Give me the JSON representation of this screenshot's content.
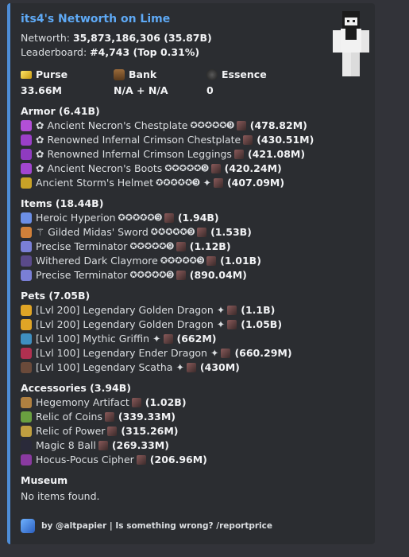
{
  "embed": {
    "title": "its4's Networth on Lime",
    "networth_label": "Networth:",
    "networth_value": "35,873,186,306 (35.87B)",
    "leaderboard_label": "Leaderboard:",
    "leaderboard_value": "#4,743 (Top 0.31%)",
    "stats": [
      {
        "label": "Purse",
        "value": "33.66M",
        "icon": "gold-bars-icon"
      },
      {
        "label": "Bank",
        "value": "N/A + N/A",
        "icon": "bank-chest-icon"
      },
      {
        "label": "Essence",
        "value": "0",
        "icon": "essence-icon"
      }
    ],
    "sections": [
      {
        "title": "Armor (6.41B)",
        "items": [
          {
            "name": "✿ Ancient Necron's Chestplate",
            "stars": "✪✪✪✪✪➒",
            "extra": "",
            "price": "(478.82M)",
            "color": "#b24fd6"
          },
          {
            "name": "✿ Renowned Infernal Crimson Chestplate",
            "stars": "",
            "extra": "",
            "price": "(430.51M)",
            "color": "#9a3fc8"
          },
          {
            "name": "✿ Renowned Infernal Crimson Leggings",
            "stars": "",
            "extra": "",
            "price": "(421.08M)",
            "color": "#8f3bc0"
          },
          {
            "name": "✿ Ancient Necron's Boots",
            "stars": "✪✪✪✪✪➒",
            "extra": "",
            "price": "(420.24M)",
            "color": "#a246cf"
          },
          {
            "name": "Ancient Storm's Helmet",
            "stars": "✪✪✪✪✪➒",
            "extra": "✦",
            "price": "(407.09M)",
            "color": "#c9a227"
          }
        ]
      },
      {
        "title": "Items (18.44B)",
        "items": [
          {
            "name": "Heroic Hyperion",
            "stars": "✪✪✪✪✪➒",
            "extra": "",
            "price": "(1.94B)",
            "color": "#6c8fe6"
          },
          {
            "name": "⚚ Gilded Midas' Sword",
            "stars": "✪✪✪✪✪➒",
            "extra": "",
            "price": "(1.53B)",
            "color": "#d0803a"
          },
          {
            "name": "Precise Terminator",
            "stars": "✪✪✪✪✪➒",
            "extra": "",
            "price": "(1.12B)",
            "color": "#7a7fd6"
          },
          {
            "name": "Withered Dark Claymore",
            "stars": "✪✪✪✪✪➒",
            "extra": "",
            "price": "(1.01B)",
            "color": "#5a4a8a"
          },
          {
            "name": "Precise Terminator",
            "stars": "✪✪✪✪✪➒",
            "extra": "",
            "price": "(890.04M)",
            "color": "#7a7fd6"
          }
        ]
      },
      {
        "title": "Pets (7.05B)",
        "items": [
          {
            "name": "[Lvl 200] Legendary Golden Dragon",
            "stars": "",
            "extra": "✦",
            "price": "(1.1B)",
            "color": "#e0a526"
          },
          {
            "name": "[Lvl 200] Legendary Golden Dragon",
            "stars": "",
            "extra": "✦",
            "price": "(1.05B)",
            "color": "#e0a526"
          },
          {
            "name": "[Lvl 100] Mythic Griffin",
            "stars": "",
            "extra": "✦",
            "price": "(662M)",
            "color": "#3f8fc0"
          },
          {
            "name": "[Lvl 100] Legendary Ender Dragon",
            "stars": "",
            "extra": "✦",
            "price": "(660.29M)",
            "color": "#b03050"
          },
          {
            "name": "[Lvl 100] Legendary Scatha",
            "stars": "",
            "extra": "✦",
            "price": "(430M)",
            "color": "#6a4a3a"
          }
        ]
      },
      {
        "title": "Accessories (3.94B)",
        "items": [
          {
            "name": "Hegemony Artifact",
            "stars": "",
            "extra": "",
            "price": "(1.02B)",
            "color": "#b08040"
          },
          {
            "name": "Relic of Coins",
            "stars": "",
            "extra": "",
            "price": "(339.33M)",
            "color": "#6aa040"
          },
          {
            "name": "Relic of Power",
            "stars": "",
            "extra": "",
            "price": "(315.26M)",
            "color": "#c0a040"
          },
          {
            "name": "Magic 8 Ball",
            "stars": "",
            "extra": "",
            "price": "(269.33M)",
            "color": "#2a2a3a"
          },
          {
            "name": "Hocus-Pocus Cipher",
            "stars": "",
            "extra": "",
            "price": "(206.96M)",
            "color": "#8a3aa0"
          }
        ]
      },
      {
        "title": "Museum",
        "text": "No items found."
      }
    ],
    "footer": "by @altpapier | Is something wrong? /reportprice"
  },
  "colors": {
    "accent_bar": "#4e8dd8",
    "title": "#5ea9f5",
    "background": "#2b2d31"
  }
}
